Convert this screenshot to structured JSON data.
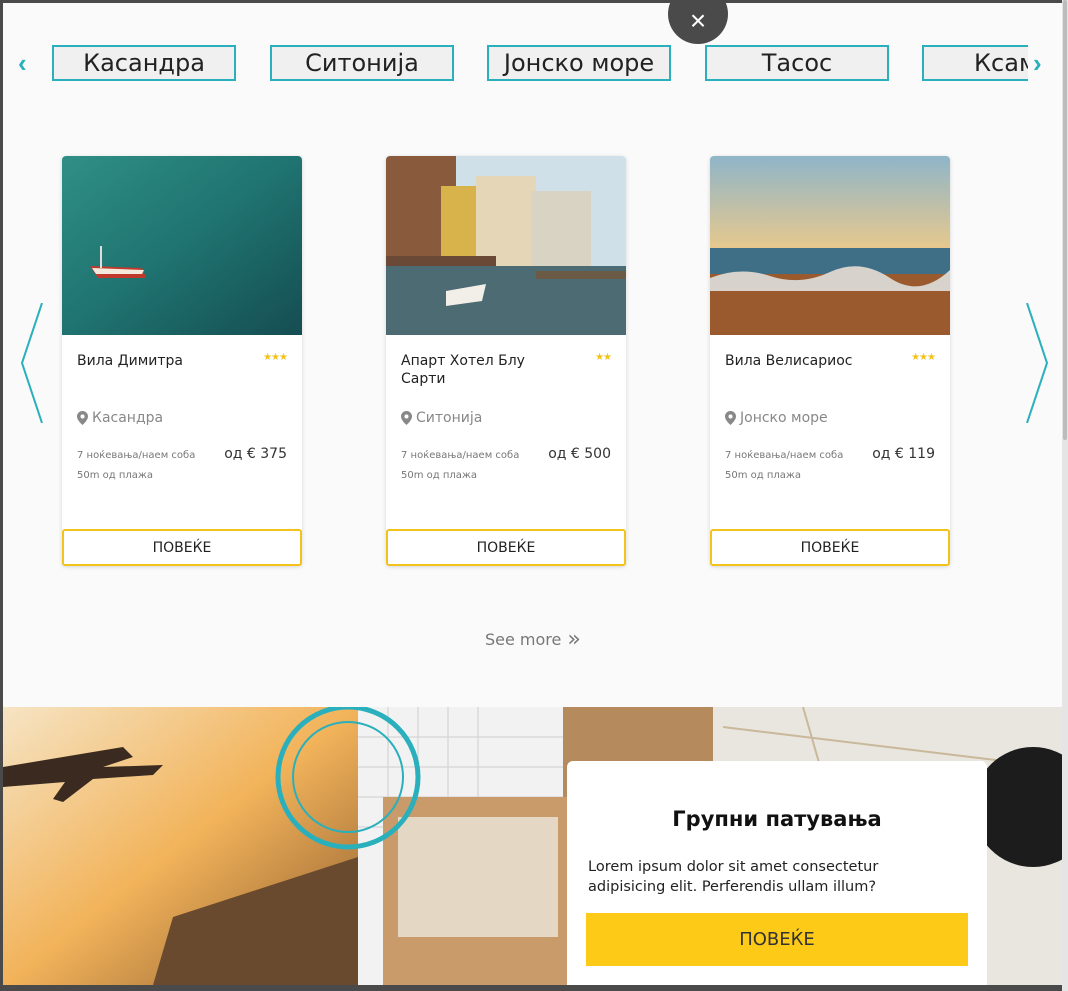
{
  "modal": {
    "close_glyph": "×",
    "close_icon": "close-icon"
  },
  "region_tabs": {
    "prev_glyph": "‹",
    "next_glyph": "›",
    "items": [
      {
        "label": "Касандра"
      },
      {
        "label": "Ситонија"
      },
      {
        "label": "Јонско море"
      },
      {
        "label": "Тасос"
      },
      {
        "label": "Ксамил"
      }
    ]
  },
  "cards": [
    {
      "name": "Вила Димитра",
      "stars": "★★★",
      "location": "Касандра",
      "info_line1": "7 ноќевања/наем соба",
      "info_line2": "50m од плажа",
      "price": "од € 375",
      "button": "ПОВЕЌЕ",
      "image": "sea-boat-photo"
    },
    {
      "name": "Апарт Хотел Блу Сарти",
      "stars": "★★",
      "location": "Ситонија",
      "info_line1": "7 ноќевања/наем соба",
      "info_line2": "50m од плажа",
      "price": "од € 500",
      "button": "ПОВЕЌЕ",
      "image": "canal-town-photo"
    },
    {
      "name": "Вила Велисариос",
      "stars": "★★★",
      "location": "Јонско море",
      "info_line1": "7 ноќевања/наем соба",
      "info_line2": "50m од плажа",
      "price": "од € 119",
      "button": "ПОВЕЌЕ",
      "image": "coast-sunset-photo"
    }
  ],
  "see_more": {
    "label": "See more",
    "glyph": "»"
  },
  "promo": {
    "title": "Групни патувања",
    "text": "Lorem ipsum dolor sit amet consectetur adipisicing elit. Perferendis ullam illum?",
    "button": "ПОВЕЌЕ"
  },
  "colors": {
    "accent": "#2ab0bc",
    "star": "#f2c31a",
    "button_yellow": "#fdca17"
  }
}
